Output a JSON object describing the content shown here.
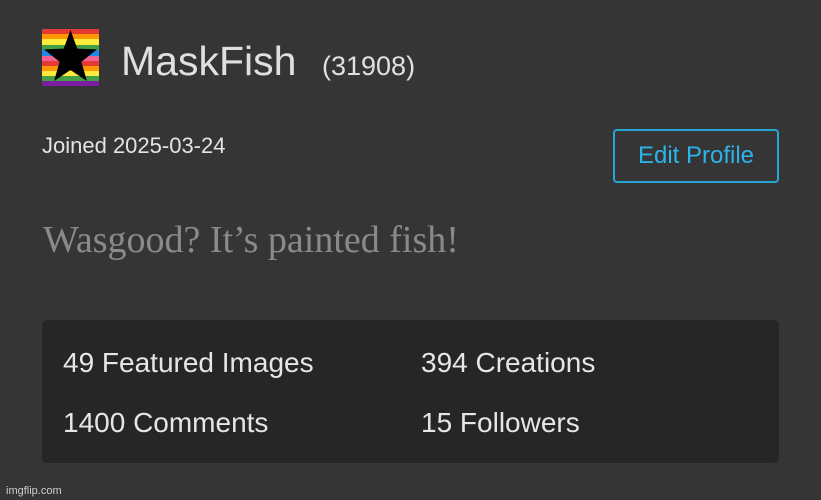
{
  "profile": {
    "username": "MaskFish",
    "score": "(31908)",
    "joined": "Joined 2025-03-24",
    "bio": "Wasgood? It’s painted fish!",
    "avatar_icon": "rainbow-star-icon",
    "avatar_colors": [
      "#e53935",
      "#ff9800",
      "#ffeb3b",
      "#43a047",
      "#1e88e5",
      "#7b1fa2",
      "#ffffff",
      "#f48fb1",
      "#64b5f6",
      "#795548"
    ]
  },
  "actions": {
    "edit_profile_label": "Edit Profile",
    "accent_color": "#2cb3ea"
  },
  "stats": {
    "featured_images": "49 Featured Images",
    "creations": "394 Creations",
    "comments": "1400 Comments",
    "followers": "15 Followers"
  },
  "watermark": "imgflip.com"
}
